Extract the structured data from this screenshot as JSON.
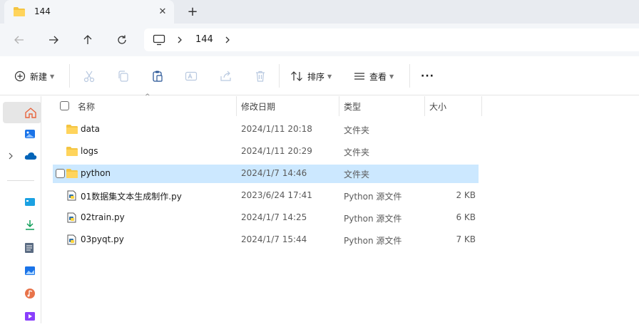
{
  "window": {
    "tab_title": "144",
    "close_label": "✕",
    "new_tab_label": "+"
  },
  "nav": {
    "breadcrumb_folder": "144"
  },
  "toolbar": {
    "new_label": "新建",
    "sort_label": "排序",
    "view_label": "查看",
    "more_label": "···"
  },
  "columns": {
    "name": "名称",
    "date": "修改日期",
    "type": "类型",
    "size": "大小"
  },
  "files": [
    {
      "name": "data",
      "date": "2024/1/11 20:18",
      "type": "文件夹",
      "size": "",
      "icon": "folder-icon",
      "selected": false
    },
    {
      "name": "logs",
      "date": "2024/1/11 20:29",
      "type": "文件夹",
      "size": "",
      "icon": "folder-icon",
      "selected": false
    },
    {
      "name": "python",
      "date": "2024/1/7 14:46",
      "type": "文件夹",
      "size": "",
      "icon": "folder-icon",
      "selected": true
    },
    {
      "name": "01数据集文本生成制作.py",
      "date": "2023/6/24 17:41",
      "type": "Python 源文件",
      "size": "2 KB",
      "icon": "python-file-icon",
      "selected": false
    },
    {
      "name": "02train.py",
      "date": "2024/1/7 14:25",
      "type": "Python 源文件",
      "size": "6 KB",
      "icon": "python-file-icon",
      "selected": false
    },
    {
      "name": "03pyqt.py",
      "date": "2024/1/7 15:44",
      "type": "Python 源文件",
      "size": "7 KB",
      "icon": "python-file-icon",
      "selected": false
    }
  ],
  "colors": {
    "selection": "#cce8ff",
    "folder": "#f4c542",
    "accent": "#0067c0"
  }
}
